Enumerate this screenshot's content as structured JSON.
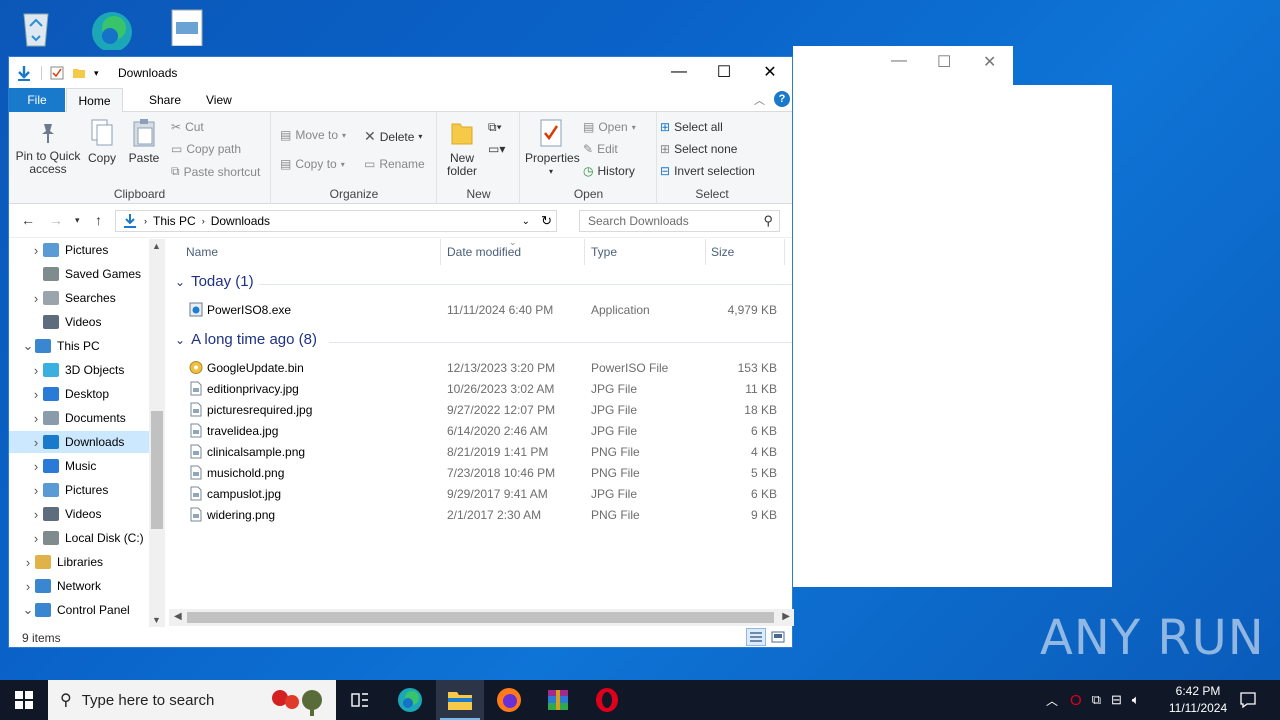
{
  "window": {
    "title": "Downloads",
    "tabs": [
      "File",
      "Home",
      "Share",
      "View"
    ]
  },
  "ribbon": {
    "clipboard": {
      "pin": "Pin to Quick access",
      "copy": "Copy",
      "paste": "Paste",
      "cut": "Cut",
      "copy_path": "Copy path",
      "paste_shortcut": "Paste shortcut",
      "label": "Clipboard"
    },
    "organize": {
      "move_to": "Move to",
      "copy_to": "Copy to",
      "delete": "Delete",
      "rename": "Rename",
      "label": "Organize"
    },
    "new": {
      "new_folder": "New folder",
      "label": "New"
    },
    "open": {
      "properties": "Properties",
      "open": "Open",
      "edit": "Edit",
      "history": "History",
      "label": "Open"
    },
    "select": {
      "select_all": "Select all",
      "select_none": "Select none",
      "invert": "Invert selection",
      "label": "Select"
    }
  },
  "address": {
    "crumbs": [
      "This PC",
      "Downloads"
    ],
    "search_placeholder": "Search Downloads"
  },
  "nav": {
    "items": [
      {
        "label": "Pictures",
        "icon": "pictures-icon",
        "indent": 1,
        "chevron": ">"
      },
      {
        "label": "Saved Games",
        "icon": "saved-games-icon",
        "indent": 1,
        "chevron": ""
      },
      {
        "label": "Searches",
        "icon": "search-folder-icon",
        "indent": 1,
        "chevron": ">"
      },
      {
        "label": "Videos",
        "icon": "videos-icon",
        "indent": 1,
        "chevron": ""
      },
      {
        "label": "This PC",
        "icon": "this-pc-icon",
        "indent": 0,
        "chevron": "v"
      },
      {
        "label": "3D Objects",
        "icon": "3d-objects-icon",
        "indent": 1,
        "chevron": ">"
      },
      {
        "label": "Desktop",
        "icon": "desktop-icon",
        "indent": 1,
        "chevron": ">"
      },
      {
        "label": "Documents",
        "icon": "documents-icon",
        "indent": 1,
        "chevron": ">"
      },
      {
        "label": "Downloads",
        "icon": "downloads-icon",
        "indent": 1,
        "chevron": ">",
        "selected": true
      },
      {
        "label": "Music",
        "icon": "music-icon",
        "indent": 1,
        "chevron": ">"
      },
      {
        "label": "Pictures",
        "icon": "pictures-icon",
        "indent": 1,
        "chevron": ">"
      },
      {
        "label": "Videos",
        "icon": "videos-icon",
        "indent": 1,
        "chevron": ">"
      },
      {
        "label": "Local Disk (C:)",
        "icon": "disk-icon",
        "indent": 1,
        "chevron": ">"
      },
      {
        "label": "Libraries",
        "icon": "libraries-icon",
        "indent": 0,
        "chevron": ">"
      },
      {
        "label": "Network",
        "icon": "network-icon",
        "indent": 0,
        "chevron": ">"
      },
      {
        "label": "Control Panel",
        "icon": "control-panel-icon",
        "indent": 0,
        "chevron": "v"
      }
    ]
  },
  "columns": {
    "name": "Name",
    "date": "Date modified",
    "type": "Type",
    "size": "Size"
  },
  "groups": [
    {
      "label": "Today (1)",
      "files": [
        {
          "name": "PowerISO8.exe",
          "date": "11/11/2024 6:40 PM",
          "type": "Application",
          "size": "4,979 KB",
          "icon": "exe-icon"
        }
      ]
    },
    {
      "label": "A long time ago (8)",
      "files": [
        {
          "name": "GoogleUpdate.bin",
          "date": "12/13/2023 3:20 PM",
          "type": "PowerISO File",
          "size": "153 KB",
          "icon": "disc-file-icon"
        },
        {
          "name": "editionprivacy.jpg",
          "date": "10/26/2023 3:02 AM",
          "type": "JPG File",
          "size": "11 KB",
          "icon": "image-file-icon"
        },
        {
          "name": "picturesrequired.jpg",
          "date": "9/27/2022 12:07 PM",
          "type": "JPG File",
          "size": "18 KB",
          "icon": "image-file-icon"
        },
        {
          "name": "travelidea.jpg",
          "date": "6/14/2020 2:46 AM",
          "type": "JPG File",
          "size": "6 KB",
          "icon": "image-file-icon"
        },
        {
          "name": "clinicalsample.png",
          "date": "8/21/2019 1:41 PM",
          "type": "PNG File",
          "size": "4 KB",
          "icon": "image-file-icon"
        },
        {
          "name": "musichold.png",
          "date": "7/23/2018 10:46 PM",
          "type": "PNG File",
          "size": "5 KB",
          "icon": "image-file-icon"
        },
        {
          "name": "campuslot.jpg",
          "date": "9/29/2017 9:41 AM",
          "type": "JPG File",
          "size": "6 KB",
          "icon": "image-file-icon"
        },
        {
          "name": "widering.png",
          "date": "2/1/2017 2:30 AM",
          "type": "PNG File",
          "size": "9 KB",
          "icon": "image-file-icon"
        }
      ]
    }
  ],
  "status": {
    "items": "9 items"
  },
  "taskbar": {
    "search_placeholder": "Type here to search",
    "time": "6:42 PM",
    "date": "11/11/2024"
  },
  "watermark": "ANY RUN",
  "colors": {
    "accent": "#1979ca",
    "selection": "#cce8ff",
    "group_text": "#1e3287",
    "taskbar": "#101828"
  }
}
